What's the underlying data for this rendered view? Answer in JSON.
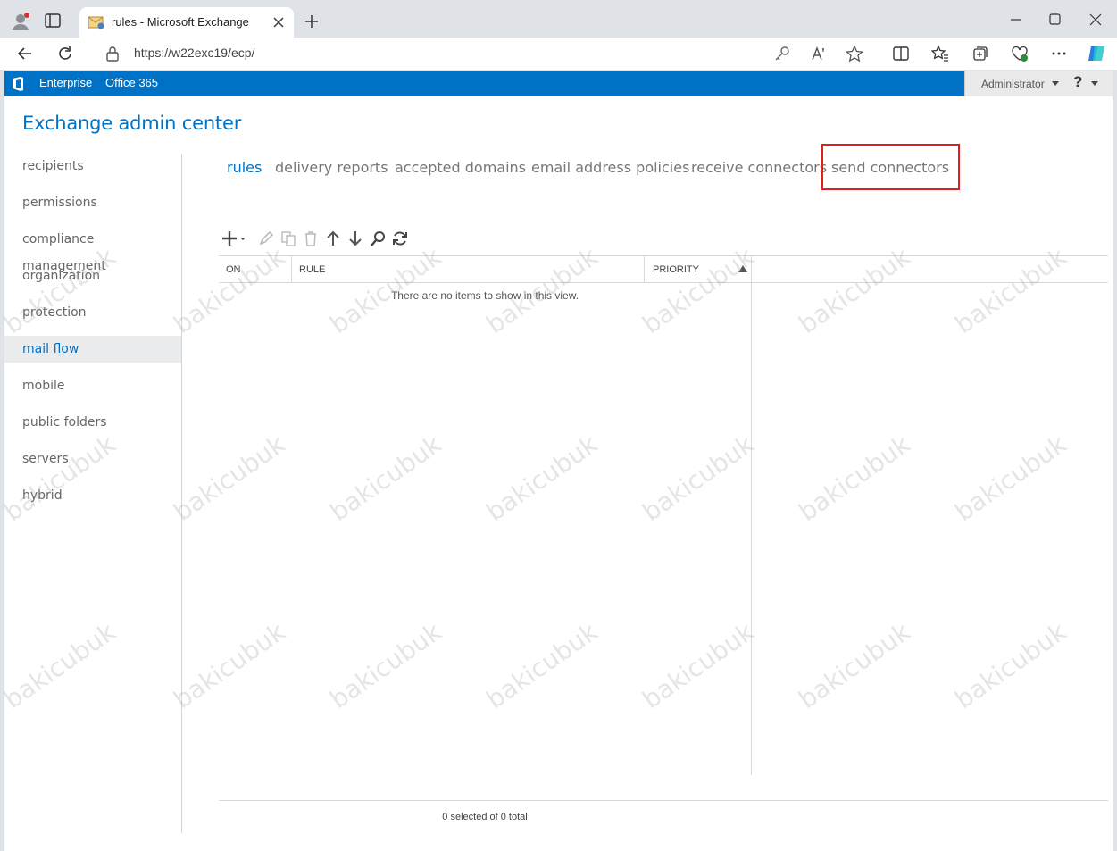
{
  "browser": {
    "tab_title": "rules - Microsoft Exchange",
    "url": "https://w22exc19/ecp/"
  },
  "topbar": {
    "enterprise": "Enterprise",
    "office365": "Office 365",
    "user": "Administrator",
    "help": "?"
  },
  "app": {
    "title": "Exchange admin center"
  },
  "sidebar": {
    "items": [
      {
        "label": "recipients"
      },
      {
        "label": "permissions"
      },
      {
        "label": "compliance management"
      },
      {
        "label": "organization"
      },
      {
        "label": "protection"
      },
      {
        "label": "mail flow"
      },
      {
        "label": "mobile"
      },
      {
        "label": "public folders"
      },
      {
        "label": "servers"
      },
      {
        "label": "hybrid"
      }
    ],
    "active": "mail flow"
  },
  "subtabs": {
    "items": [
      {
        "label": "rules"
      },
      {
        "label": "delivery reports"
      },
      {
        "label": "accepted domains"
      },
      {
        "label": "email address policies"
      },
      {
        "label": "receive connectors"
      },
      {
        "label": "send connectors"
      }
    ],
    "active": "rules",
    "highlighted": "send connectors"
  },
  "toolbar": {
    "icons": [
      "add-icon",
      "edit-icon",
      "copy-icon",
      "delete-icon",
      "move-up-icon",
      "move-down-icon",
      "search-icon",
      "refresh-icon"
    ]
  },
  "grid": {
    "columns": [
      "ON",
      "RULE",
      "PRIORITY"
    ],
    "empty_message": "There are no items to show in this view.",
    "status": "0 selected of 0 total"
  },
  "watermark": "bakicubuk",
  "colors": {
    "accent": "#0072c6",
    "highlight": "#e02020"
  }
}
